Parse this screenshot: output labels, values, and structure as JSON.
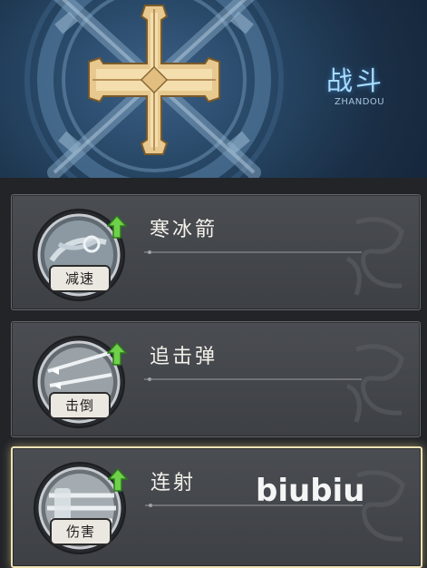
{
  "header": {
    "title": "战斗",
    "subtitle": "ZHANDOU",
    "emblem_icon": "cross-emblem-icon"
  },
  "skills": [
    {
      "name": "寒冰箭",
      "tag": "减速",
      "icon": "ice-arrow-icon",
      "upgradable": true,
      "selected": false
    },
    {
      "name": "追击弹",
      "tag": "击倒",
      "icon": "pursuit-bullet-icon",
      "upgradable": true,
      "selected": false
    },
    {
      "name": "连射",
      "tag": "伤害",
      "icon": "rapid-fire-icon",
      "upgradable": true,
      "selected": true
    }
  ],
  "watermark": "biubiu",
  "colors": {
    "title_blue": "#a7dcff",
    "card_bg": "#45484d",
    "selected_border": "#efe2b4",
    "upgrade_green": "#6fd04a"
  }
}
